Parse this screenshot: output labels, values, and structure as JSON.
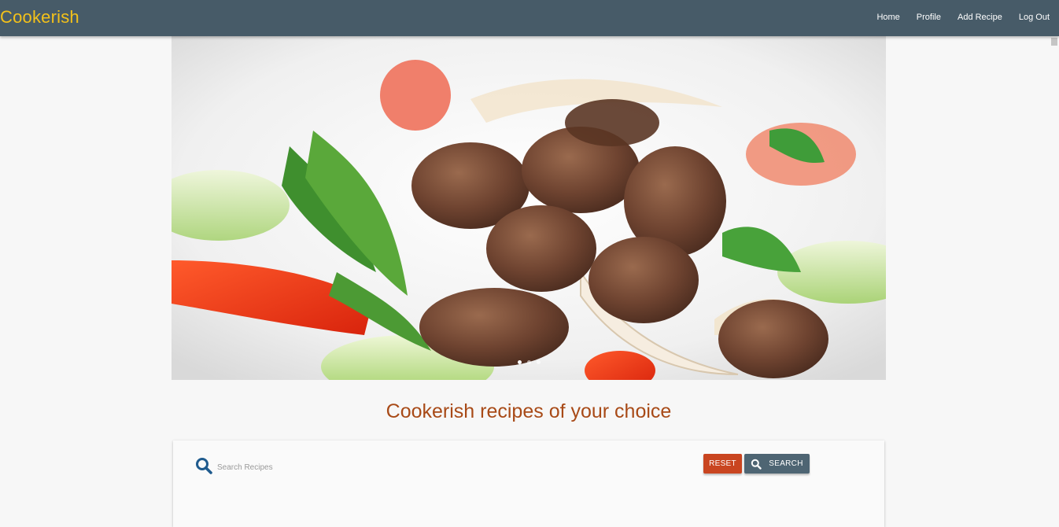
{
  "navbar": {
    "brand": "Cookerish",
    "links": [
      {
        "label": "Home"
      },
      {
        "label": "Profile"
      },
      {
        "label": "Add Recipe"
      },
      {
        "label": "Log Out"
      }
    ]
  },
  "hero": {
    "image_subject": "beef salad with tomato, cucumber and greens",
    "slide_count": 3,
    "active_slide": 1
  },
  "main": {
    "heading": "Cookerish recipes of your choice"
  },
  "search": {
    "placeholder": "Search Recipes",
    "value": "",
    "icon": "search-icon",
    "reset_label": "RESET",
    "search_label": "SEARCH"
  },
  "colors": {
    "navbar": "#475b68",
    "brand": "#f3c11a",
    "heading": "#a84a17",
    "reset_button": "#c94520",
    "search_button": "#4e6573",
    "search_icon": "#1f5b8e"
  }
}
